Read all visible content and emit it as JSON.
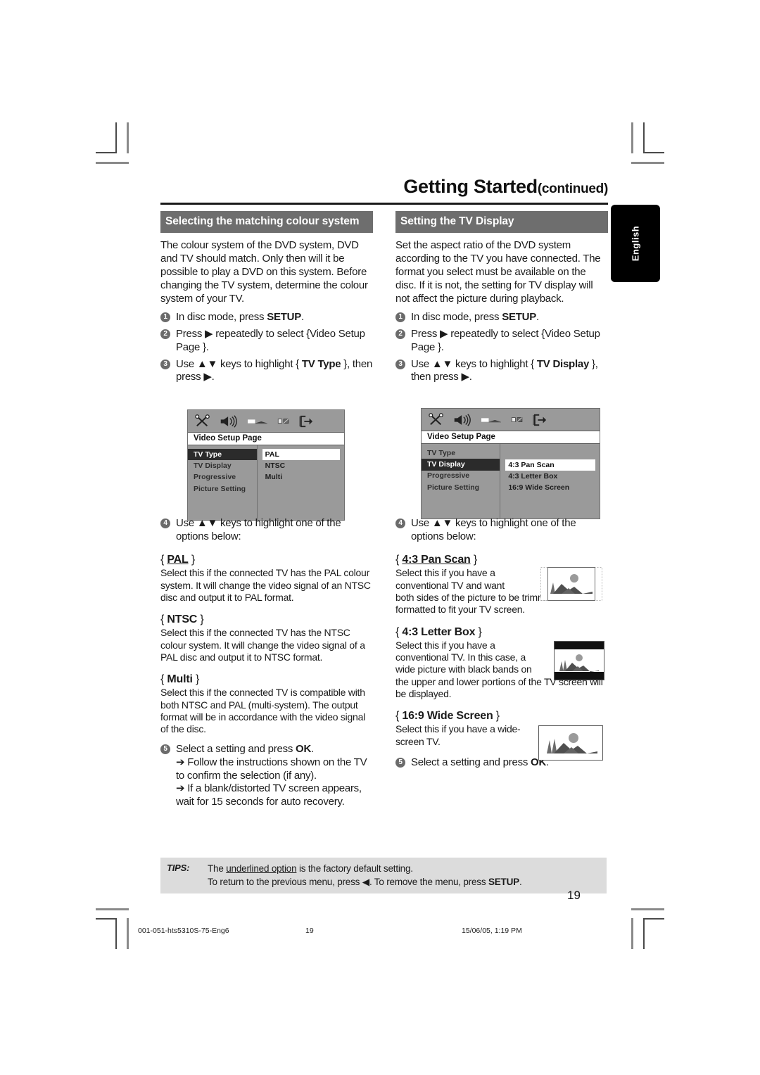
{
  "header": {
    "title": "Getting Started",
    "continued": "(continued)"
  },
  "side_tab": {
    "label": "English"
  },
  "left_column": {
    "section_heading": "Selecting the matching colour system",
    "intro": "The colour system of the DVD system, DVD and TV should match. Only then will it be possible to play a DVD on this system.  Before changing the TV system, determine the colour system of your TV.",
    "steps": [
      {
        "num": "1",
        "text": "In disc mode, press ",
        "bold": "SETUP",
        "tail": "."
      },
      {
        "num": "2",
        "text": "Press ▶ repeatedly to select {Video Setup Page }."
      },
      {
        "num": "3",
        "text": "Use ▲▼ keys to highlight { ",
        "bold": "TV Type",
        "tail": " }, then press ▶."
      },
      {
        "num": "4",
        "text": "Use ▲▼ keys to highlight one of the options below:"
      },
      {
        "num": "5",
        "text": "Select a setting and press ",
        "bold": "OK",
        "tail": ".",
        "arrows": [
          "➔ Follow the instructions shown on the TV to confirm the selection (if any).",
          "➔ If a blank/distorted TV screen appears, wait for 15 seconds for auto recovery."
        ]
      }
    ],
    "osd": {
      "title": "Video Setup Page",
      "menu_items": [
        "TV Type",
        "TV Display",
        "Progressive",
        "Picture Setting"
      ],
      "selected_menu_item": "TV Type",
      "options": [
        "PAL",
        "NTSC",
        "Multi"
      ],
      "selected_option": "PAL",
      "icons": [
        "tools-icon",
        "speaker-icon",
        "video-slider-icon",
        "preference-icon",
        "exit-icon"
      ]
    },
    "options": [
      {
        "open": "{ ",
        "name": "PAL",
        "close": " }",
        "underlined": true,
        "body": "Select this if the connected TV has the PAL colour system. It will change the video signal of an NTSC disc and output it to PAL format."
      },
      {
        "open": "{ ",
        "name": "NTSC",
        "close": " }",
        "underlined": false,
        "body": "Select this if the connected TV has the NTSC colour system. It will change the video signal of a PAL disc and output it to NTSC format."
      },
      {
        "open": "{ ",
        "name": "Multi",
        "close": " }",
        "underlined": false,
        "body": "Select this if the connected TV is compatible with both NTSC and PAL (multi-system). The output format will be in accordance with the video signal of the disc."
      }
    ]
  },
  "right_column": {
    "section_heading": "Setting the TV Display",
    "intro": "Set the aspect ratio of the DVD system according to the TV you have connected. The format you select must be available on the disc.  If it is not, the setting for TV display will not affect the picture during playback.",
    "steps": [
      {
        "num": "1",
        "text": "In disc mode, press ",
        "bold": "SETUP",
        "tail": "."
      },
      {
        "num": "2",
        "text": "Press ▶ repeatedly to select {Video Setup Page }."
      },
      {
        "num": "3",
        "text": "Use ▲▼ keys to highlight { ",
        "bold": "TV Display",
        "tail": " }, then press ▶."
      },
      {
        "num": "4",
        "text": "Use ▲▼ keys to highlight one of the options below:"
      },
      {
        "num": "5",
        "text": "Select a setting and press ",
        "bold": "OK",
        "tail": "."
      }
    ],
    "osd": {
      "title": "Video Setup Page",
      "menu_items": [
        "TV Type",
        "TV Display",
        "Progressive",
        "Picture Setting"
      ],
      "selected_menu_item": "TV Display",
      "options": [
        "4:3 Pan Scan",
        "4:3 Letter Box",
        "16:9 Wide Screen"
      ],
      "selected_option": "4:3 Pan Scan",
      "icons": [
        "tools-icon",
        "speaker-icon",
        "video-slider-icon",
        "preference-icon",
        "exit-icon"
      ]
    },
    "options": [
      {
        "open": "{ ",
        "name": "4:3 Pan Scan",
        "close": " }",
        "underlined": true,
        "body_short": "Select this if you have a conventional TV and want",
        "body_rest": "both sides of the picture to be trimmed or formatted to fit your TV screen.",
        "illustration": "pan-scan-tv-illustration"
      },
      {
        "open": "{ ",
        "name": "4:3 Letter Box",
        "close": " }",
        "underlined": false,
        "body_short": "Select this if you have a conventional TV.  In this case, a wide picture with black bands on",
        "body_rest": "the upper and lower portions of the TV screen will be displayed.",
        "illustration": "letter-box-tv-illustration"
      },
      {
        "open": "{ ",
        "name": "16:9 Wide Screen",
        "close": " }",
        "underlined": false,
        "body_short": "Select this if you have a wide-screen TV.",
        "body_rest": "",
        "illustration": "wide-screen-tv-illustration"
      }
    ]
  },
  "tips": {
    "label": "TIPS:",
    "line1_a": "The ",
    "line1_u": "underlined option",
    "line1_b": " is the factory default setting.",
    "line2_a": "To return to the previous menu, press ◀.  To remove the menu, press ",
    "line2_b": "SETUP",
    "line2_c": "."
  },
  "footer": {
    "page_number": "19",
    "file_name": "001-051-hts5310S-75-Eng6",
    "folio": "19",
    "timestamp": "15/06/05, 1:19 PM"
  },
  "colors": {
    "heading_bg": "#6e6e6e",
    "tips_bg": "#dcdcdc",
    "osd_bg": "#9a9a9a",
    "osd_sel": "#2b2b2b"
  }
}
